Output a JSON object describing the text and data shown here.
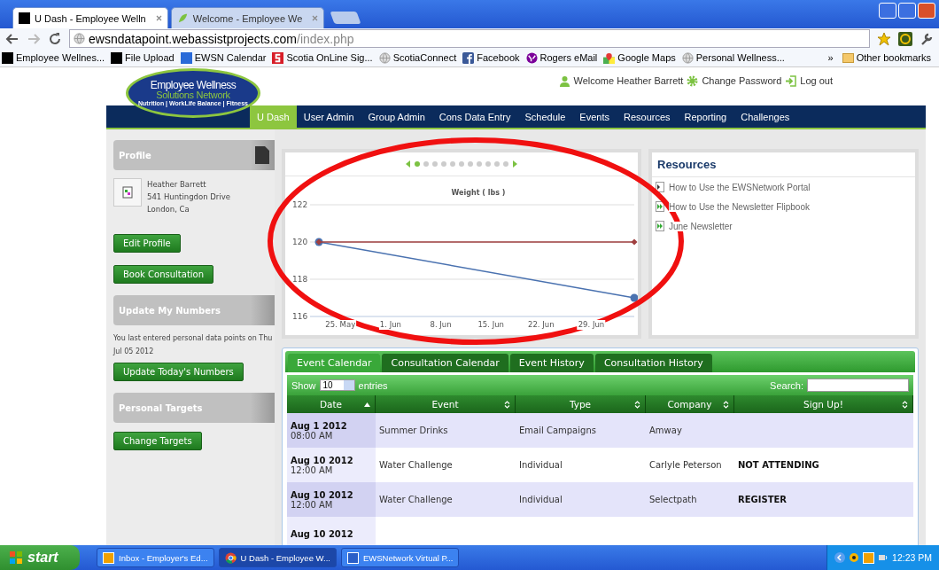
{
  "browser": {
    "tabs": [
      {
        "title": "U Dash - Employee Welln",
        "selected": true,
        "kind": "square"
      },
      {
        "title": "Welcome - Employee We",
        "selected": false,
        "kind": "leaf"
      }
    ],
    "url": {
      "host": "ewsndatapoint.webassistprojects.com",
      "path": "/index.php"
    },
    "bookmarks": [
      {
        "label": "Employee Wellnes...",
        "kind": "square"
      },
      {
        "label": "File Upload",
        "kind": "square"
      },
      {
        "label": "EWSN Calendar",
        "kind": "calendar"
      },
      {
        "label": "Scotia OnLine Sig...",
        "kind": "scotia"
      },
      {
        "label": "ScotiaConnect",
        "kind": "globe"
      },
      {
        "label": "Facebook",
        "kind": "facebook"
      },
      {
        "label": "Rogers eMail",
        "kind": "yahoo"
      },
      {
        "label": "Google Maps",
        "kind": "maps"
      },
      {
        "label": "Personal Wellness...",
        "kind": "globe"
      }
    ],
    "overflow": "»",
    "other_bookmarks": "Other bookmarks"
  },
  "header": {
    "logo": {
      "line1": "Employee Wellness",
      "line2": "Solutions Network",
      "tagline": "Nutrition | WorkLife Balance | Fitness"
    },
    "welcome": "Welcome Heather Barrett",
    "change_password": "Change Password",
    "log_out": "Log out"
  },
  "nav": [
    {
      "label": "U Dash",
      "selected": true
    },
    {
      "label": "User Admin",
      "selected": false
    },
    {
      "label": "Group Admin",
      "selected": false
    },
    {
      "label": "Cons Data Entry",
      "selected": false
    },
    {
      "label": "Schedule",
      "selected": false
    },
    {
      "label": "Events",
      "selected": false
    },
    {
      "label": "Resources",
      "selected": false
    },
    {
      "label": "Reporting",
      "selected": false
    },
    {
      "label": "Challenges",
      "selected": false
    }
  ],
  "sidebar": {
    "profile": {
      "title": "Profile",
      "name": "Heather Barrett",
      "address": "541 Huntingdon Drive",
      "city": "London, Ca",
      "buttons": [
        "Edit Profile",
        "Book Consultation"
      ]
    },
    "numbers": {
      "title": "Update My Numbers",
      "text": "You last entered personal data points on Thu Jul 05 2012",
      "button": "Update Today's Numbers"
    },
    "targets": {
      "title": "Personal Targets",
      "button": "Change Targets"
    }
  },
  "chart_panel": {
    "pager": [
      {
        "selected": true
      },
      {
        "selected": false
      },
      {
        "selected": false
      },
      {
        "selected": false
      },
      {
        "selected": false
      },
      {
        "selected": false
      },
      {
        "selected": false
      },
      {
        "selected": false
      },
      {
        "selected": false
      },
      {
        "selected": false
      },
      {
        "selected": false
      }
    ],
    "chart_data": {
      "type": "line",
      "title": "Weight ( lbs )",
      "x": [
        "2012-05-22",
        "2012-07-05"
      ],
      "series": [
        {
          "color": "#4a72b0",
          "marker": "circle",
          "values": [
            120,
            117
          ]
        },
        {
          "color": "#a04040",
          "marker": "diamond",
          "values": [
            120,
            120
          ]
        }
      ],
      "xlim": [
        "2012-05-22",
        "2012-07-05"
      ],
      "ylim": [
        116,
        122
      ],
      "xticks": [
        {
          "value": "2012-05-25",
          "label": "25. May"
        },
        {
          "value": "2012-06-01",
          "label": "1. Jun"
        },
        {
          "value": "2012-06-08",
          "label": "8. Jun"
        },
        {
          "value": "2012-06-15",
          "label": "15. Jun"
        },
        {
          "value": "2012-06-22",
          "label": "22. Jun"
        },
        {
          "value": "2012-06-29",
          "label": "29. Jun"
        }
      ],
      "yticks": [
        116,
        118,
        120,
        122
      ]
    }
  },
  "resources": {
    "title": "Resources",
    "items": [
      {
        "label": "How to Use the EWSNetwork Portal",
        "kind": "page"
      },
      {
        "label": "How to Use the Newsletter Flipbook",
        "kind": "play"
      },
      {
        "label": "June Newsletter",
        "kind": "play"
      }
    ]
  },
  "events": {
    "tabs": [
      {
        "label": "Event Calendar",
        "selected": true
      },
      {
        "label": "Consultation Calendar",
        "selected": false
      },
      {
        "label": "Event History",
        "selected": false
      },
      {
        "label": "Consultation History",
        "selected": false
      }
    ],
    "show_label": "Show",
    "entries_value": "10",
    "entries_label": "entries",
    "search_label": "Search:",
    "columns": [
      {
        "label": "Date",
        "sorted": true
      },
      {
        "label": "Event",
        "sorted": false
      },
      {
        "label": "Type",
        "sorted": false
      },
      {
        "label": "Company",
        "sorted": false
      },
      {
        "label": "Sign Up!",
        "sorted": false
      }
    ],
    "rows": [
      {
        "date": "Aug 1 2012",
        "time": "08:00 AM",
        "event": "Summer Drinks",
        "type": "Email Campaigns",
        "company": "Amway"
      },
      {
        "date": "Aug 10 2012",
        "time": "12:00 AM",
        "event": "Water Challenge",
        "type": "Individual",
        "company": "Carlyle Peterson",
        "signup": "NOT ATTENDING"
      },
      {
        "date": "Aug 10 2012",
        "time": "12:00 AM",
        "event": "Water Challenge",
        "type": "Individual",
        "company": "Selectpath",
        "signup": "REGISTER"
      },
      {
        "date": "Aug 10 2012"
      }
    ]
  },
  "taskbar": {
    "start": "start",
    "tasks": [
      {
        "label": "Inbox - Employer's Ed...",
        "selected": false,
        "kind": "outlook"
      },
      {
        "label": "U Dash - Employee W...",
        "selected": true,
        "kind": "chrome"
      },
      {
        "label": "EWSNetwork Virtual P...",
        "selected": false,
        "kind": "word"
      }
    ],
    "clock": "12:23 PM"
  }
}
